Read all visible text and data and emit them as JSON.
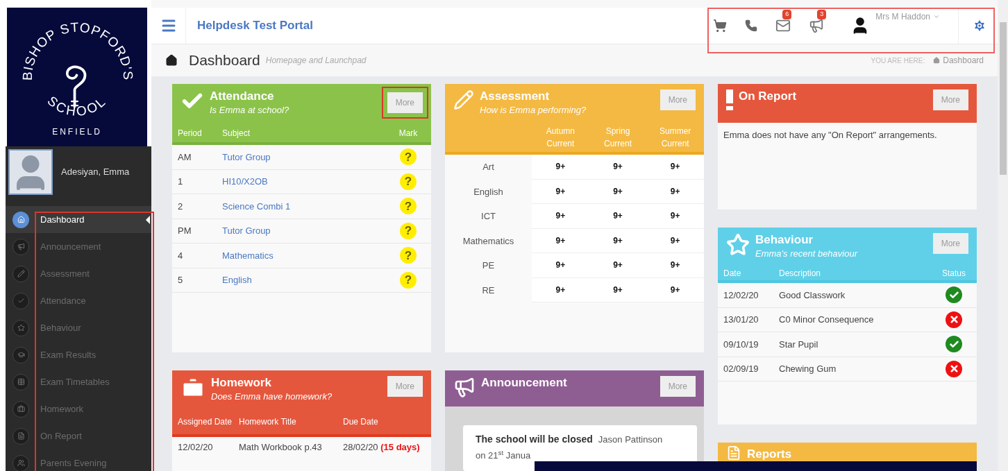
{
  "logo": {
    "arc_top": "BISHOP STOPFORD'S",
    "arc_bottom": "SCHOOL",
    "place": "ENFIELD"
  },
  "profile": {
    "name": "Adesiyan, Emma"
  },
  "nav": [
    {
      "label": "Dashboard",
      "selected": true
    },
    {
      "label": "Announcement",
      "selected": false
    },
    {
      "label": "Assessment",
      "selected": false
    },
    {
      "label": "Attendance",
      "selected": false
    },
    {
      "label": "Behaviour",
      "selected": false
    },
    {
      "label": "Exam Results",
      "selected": false
    },
    {
      "label": "Exam Timetables",
      "selected": false
    },
    {
      "label": "Homework",
      "selected": false
    },
    {
      "label": "On Report",
      "selected": false
    },
    {
      "label": "Parents Evening",
      "selected": false
    }
  ],
  "header": {
    "title": "Helpdesk Test Portal",
    "mail_count": "6",
    "announcement_count": "3",
    "user": "Mrs M Haddon"
  },
  "page": {
    "title": "Dashboard",
    "subtitle": "Homepage and Launchpad",
    "breadcrumb_label": "YOU ARE HERE:",
    "breadcrumb": "Dashboard"
  },
  "attendance": {
    "title": "Attendance",
    "subtitle": "Is Emma at school?",
    "more": "More",
    "columns": [
      "Period",
      "Subject",
      "Mark"
    ],
    "rows": [
      {
        "period": "AM",
        "subject": "Tutor Group",
        "mark": "?"
      },
      {
        "period": "1",
        "subject": "HI10/X2OB",
        "mark": "?"
      },
      {
        "period": "2",
        "subject": "Science Combi 1",
        "mark": "?"
      },
      {
        "period": "PM",
        "subject": "Tutor Group",
        "mark": "?"
      },
      {
        "period": "4",
        "subject": "Mathematics",
        "mark": "?"
      },
      {
        "period": "5",
        "subject": "English",
        "mark": "?"
      }
    ]
  },
  "assessment": {
    "title": "Assessment",
    "subtitle": "How is Emma performing?",
    "more": "More",
    "columns": [
      "Autumn Current",
      "Spring Current",
      "Summer Current"
    ],
    "rows": [
      {
        "subject": "Art",
        "grades": [
          "9+",
          "9+",
          "9+"
        ]
      },
      {
        "subject": "English",
        "grades": [
          "9+",
          "9+",
          "9+"
        ]
      },
      {
        "subject": "ICT",
        "grades": [
          "9+",
          "9+",
          "9+"
        ]
      },
      {
        "subject": "Mathematics",
        "grades": [
          "9+",
          "9+",
          "9+"
        ]
      },
      {
        "subject": "PE",
        "grades": [
          "9+",
          "9+",
          "9+"
        ]
      },
      {
        "subject": "RE",
        "grades": [
          "9+",
          "9+",
          "9+"
        ]
      }
    ]
  },
  "on_report": {
    "title": "On Report",
    "more": "More",
    "message": "Emma does not have any \"On Report\" arrangements."
  },
  "behaviour": {
    "title": "Behaviour",
    "subtitle": "Emma's recent behaviour",
    "more": "More",
    "columns": [
      "Date",
      "Description",
      "Status"
    ],
    "rows": [
      {
        "date": "12/02/20",
        "description": "Good Classwork",
        "kind": "positive"
      },
      {
        "date": "13/01/20",
        "description": "C0 Minor Consequence",
        "kind": "negative"
      },
      {
        "date": "09/10/19",
        "description": "Star Pupil",
        "kind": "positive"
      },
      {
        "date": "02/09/19",
        "description": "Chewing Gum",
        "kind": "negative"
      }
    ]
  },
  "homework": {
    "title": "Homework",
    "subtitle": "Does Emma have homework?",
    "more": "More",
    "columns": [
      "Assigned Date",
      "Homework Title",
      "Due Date"
    ],
    "rows": [
      {
        "assigned": "12/02/20",
        "title": "Math Workbook p.43",
        "due": "28/02/20",
        "remaining": "(15 days)"
      }
    ]
  },
  "announcement": {
    "title": "Announcement",
    "more": "More",
    "heading": "The school will be closed",
    "author": "Jason Pattinson",
    "text": "on 21$^{st}$ Janua"
  },
  "reports": {
    "title": "Reports"
  }
}
